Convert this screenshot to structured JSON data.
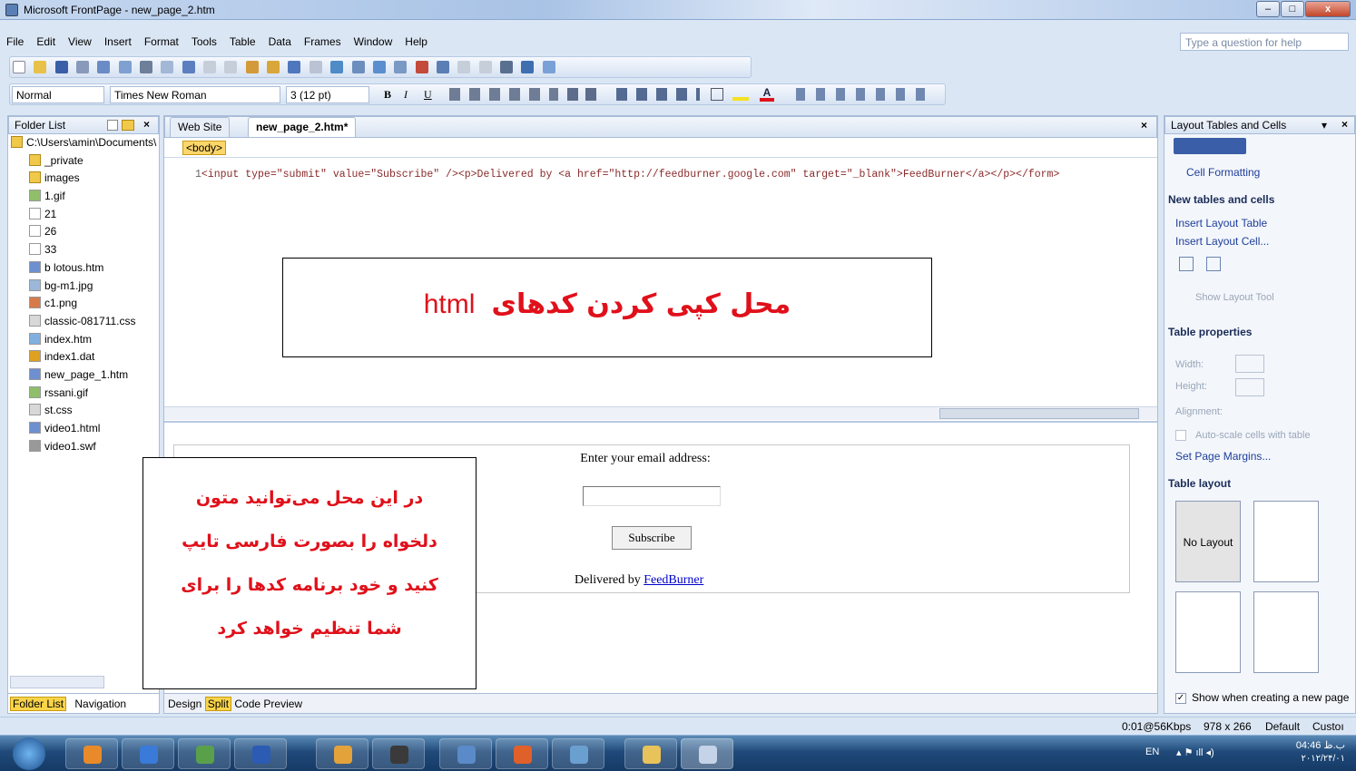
{
  "window": {
    "title": "Microsoft FrontPage - new_page_2.htm"
  },
  "menu": [
    "File",
    "Edit",
    "View",
    "Insert",
    "Format",
    "Tools",
    "Table",
    "Data",
    "Frames",
    "Window",
    "Help"
  ],
  "help_placeholder": "Type a question for help",
  "format_bar": {
    "style": "Normal",
    "font": "Times New Roman",
    "size": "3 (12 pt)"
  },
  "folder_list": {
    "title": "Folder List",
    "root": "C:\\Users\\amin\\Documents\\",
    "items": [
      "_private",
      "images",
      "1.gif",
      "21",
      "26",
      "33",
      "b lotous.htm",
      "bg-m1.jpg",
      "c1.png",
      "classic-081711.css",
      "index.htm",
      "index1.dat",
      "new_page_1.htm",
      "rssani.gif",
      "st.css",
      "video1.html",
      "video1.swf"
    ],
    "tabs": [
      "Folder List",
      "Navigation"
    ]
  },
  "editor": {
    "tabs": [
      "Web Site",
      "new_page_2.htm*"
    ],
    "tag": "<body>",
    "line_number": "1",
    "code": "<input type=\"submit\" value=\"Subscribe\" /><p>Delivered by <a href=\"http://feedburner.google.com\" target=\"_blank\">FeedBurner</a></p></form>",
    "view_tabs": [
      "Design",
      "Split",
      "Code",
      "Preview"
    ]
  },
  "preview": {
    "email_label": "Enter your email address:",
    "subscribe": "Subscribe",
    "delivered": "Delivered by",
    "link": "FeedBurner"
  },
  "annotations": {
    "code_note_fa": "محل کپی کردن کدهای",
    "code_note_en": "html",
    "design_note": [
      "در این محل می‌توانید متون",
      "دلخواه را بصورت فارسی تایپ",
      "کنید و خود برنامه کدها را برای",
      "شما تنظیم خواهد کرد"
    ]
  },
  "right_panel": {
    "title": "Layout Tables and Cells",
    "cell_formatting": "Cell Formatting",
    "new_tables": "New tables and cells",
    "insert_table": "Insert Layout Table",
    "insert_cell": "Insert Layout Cell...",
    "show_tool": "Show Layout Tool",
    "table_props": "Table properties",
    "width": "Width:",
    "height": "Height:",
    "alignment": "Alignment:",
    "autoscale": "Auto-scale cells with table",
    "margins": "Set Page Margins...",
    "table_layout": "Table layout",
    "no_layout": "No Layout",
    "show_new": "Show when creating a new page"
  },
  "status": {
    "speed": "0:01@56Kbps",
    "size": "978 x 266",
    "mode": "Default",
    "custom": "Custoı"
  },
  "taskbar": {
    "lang": "EN",
    "time": "04:46 ب.ظ",
    "date": "۲۰۱۲/۲۴/۰۱"
  }
}
